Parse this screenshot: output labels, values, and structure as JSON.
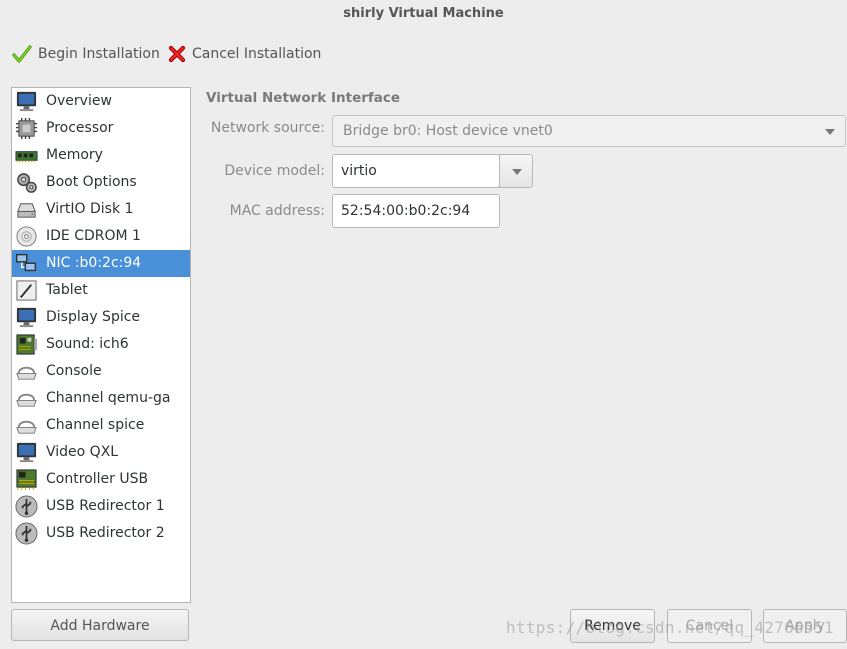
{
  "window": {
    "title": "shirly Virtual Machine"
  },
  "toolbar": {
    "begin_label": "Begin Installation",
    "cancel_label": "Cancel Installation"
  },
  "sidebar": {
    "items": [
      {
        "label": "Overview",
        "icon": "monitor-icon"
      },
      {
        "label": "Processor",
        "icon": "cpu-icon"
      },
      {
        "label": "Memory",
        "icon": "memory-icon"
      },
      {
        "label": "Boot Options",
        "icon": "gears-icon"
      },
      {
        "label": "VirtIO Disk 1",
        "icon": "disk-icon"
      },
      {
        "label": "IDE CDROM 1",
        "icon": "cdrom-icon"
      },
      {
        "label": "NIC :b0:2c:94",
        "icon": "network-icon",
        "selected": true
      },
      {
        "label": "Tablet",
        "icon": "tablet-icon"
      },
      {
        "label": "Display Spice",
        "icon": "display-icon"
      },
      {
        "label": "Sound: ich6",
        "icon": "sound-card-icon"
      },
      {
        "label": "Console",
        "icon": "serial-icon"
      },
      {
        "label": "Channel qemu-ga",
        "icon": "serial-icon"
      },
      {
        "label": "Channel spice",
        "icon": "serial-icon"
      },
      {
        "label": "Video QXL",
        "icon": "display-icon"
      },
      {
        "label": "Controller USB",
        "icon": "controller-icon"
      },
      {
        "label": "USB Redirector 1",
        "icon": "usb-icon"
      },
      {
        "label": "USB Redirector 2",
        "icon": "usb-icon"
      }
    ],
    "add_hardware_label": "Add Hardware"
  },
  "details": {
    "section_title": "Virtual Network Interface",
    "network_source_label": "Network source:",
    "network_source_value": "Bridge br0: Host device vnet0",
    "device_model_label": "Device model:",
    "device_model_value": "virtio",
    "mac_label": "MAC address:",
    "mac_value": "52:54:00:b0:2c:94"
  },
  "footer": {
    "remove_label": "Remove",
    "cancel_label": "Cancel",
    "apply_label": "Apply"
  },
  "watermark": "https://blog.csdn.net/qq_42766551",
  "colors": {
    "selection": "#4a90d9",
    "check_green": "#4e9a06",
    "cancel_red": "#cc2222"
  }
}
